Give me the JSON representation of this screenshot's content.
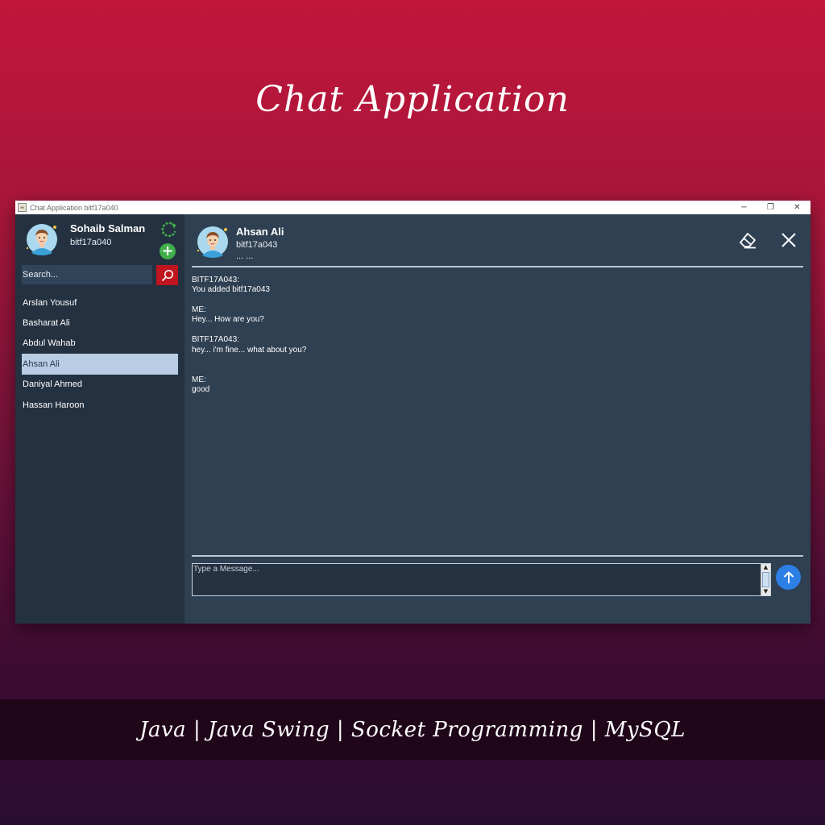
{
  "poster": {
    "title": "Chat Application",
    "footer": "Java | Java Swing | Socket Programming | MySQL"
  },
  "window": {
    "title": "Chat Application bitf17a040",
    "controls": {
      "minimize": "−",
      "maximize": "❐",
      "close": "✕"
    }
  },
  "sidebar": {
    "user_name": "Sohaib Salman",
    "user_id": "bitf17a040",
    "search_placeholder": "Search...",
    "contacts": [
      {
        "label": "Arslan Yousuf"
      },
      {
        "label": "Basharat Ali"
      },
      {
        "label": "Abdul Wahab"
      },
      {
        "label": "Ahsan Ali",
        "selected": true
      },
      {
        "label": "Daniyal Ahmed"
      },
      {
        "label": "Hassan Haroon"
      }
    ]
  },
  "chat": {
    "contact_name": "Ahsan Ali",
    "contact_id": "bitf17a043",
    "status": "... ...",
    "messages": [
      {
        "sender": "BITF17A043:",
        "text": "You added bitf17a043"
      },
      {
        "sender": "ME:",
        "text": "Hey... How are you?"
      },
      {
        "sender": "BITF17A043:",
        "text": "hey... i'm fine... what about you?"
      },
      {
        "sender": "ME:",
        "text": "good"
      }
    ],
    "input_placeholder": "Type a Message..."
  },
  "colors": {
    "send_button": "#2d7fe6",
    "search_button": "#c0141e",
    "add_button": "#3fae4a",
    "selected_contact": "#b8cde3"
  }
}
